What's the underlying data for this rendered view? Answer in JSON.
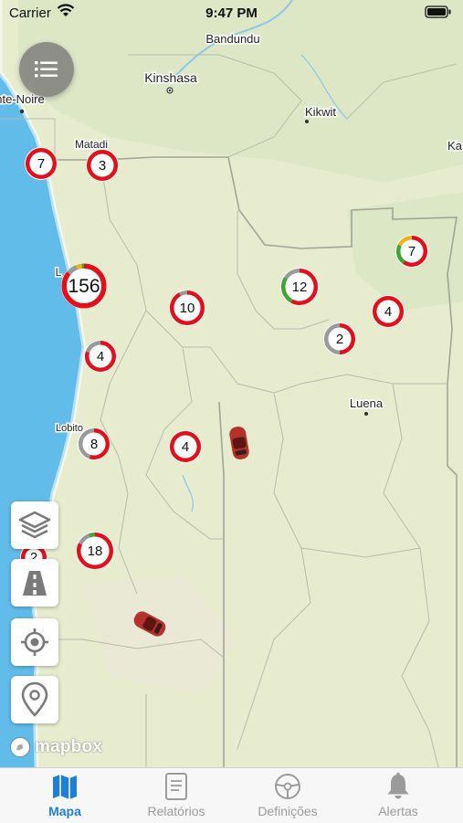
{
  "status_bar": {
    "carrier": "Carrier",
    "time": "9:47 PM"
  },
  "map": {
    "places": [
      "Bandundu",
      "Kinshasa",
      "nte-Noire",
      "Kikwit",
      "Matadi",
      "Ka",
      "Luena",
      "L",
      "Lobito"
    ],
    "clusters": [
      "7",
      "3",
      "156",
      "10",
      "12",
      "7",
      "4",
      "2",
      "4",
      "8",
      "4",
      "18",
      "2"
    ],
    "attribution": "mapbox",
    "colors": {
      "cluster_red": "#e3101b",
      "cluster_grey": "#9a9a9a",
      "cluster_green": "#3fa535",
      "cluster_yellow": "#f1b21b",
      "water": "#62bcea",
      "land": "#e7eccf",
      "accent": "#1f7ed8"
    }
  },
  "controls": {
    "menu_icon": "list-icon",
    "layers_icon": "layers-icon",
    "road_icon": "road-icon",
    "locate_icon": "crosshair-icon",
    "pin_icon": "map-pin-icon"
  },
  "tabs": [
    {
      "label": "Mapa",
      "icon": "map-icon",
      "active": true
    },
    {
      "label": "Relatórios",
      "icon": "document-icon",
      "active": false
    },
    {
      "label": "Definições",
      "icon": "steering-wheel-icon",
      "active": false
    },
    {
      "label": "Alertas",
      "icon": "bell-icon",
      "active": false
    }
  ]
}
